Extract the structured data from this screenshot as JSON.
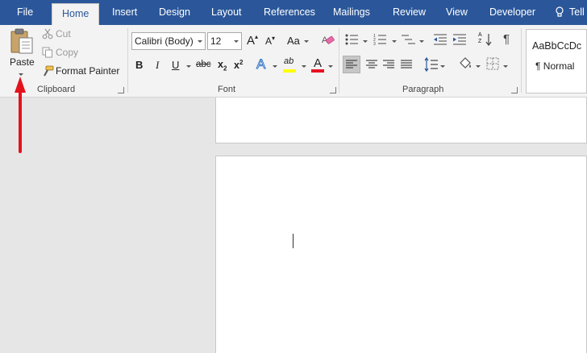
{
  "tabs": {
    "file": "File",
    "home": "Home",
    "insert": "Insert",
    "design": "Design",
    "layout": "Layout",
    "references": "References",
    "mailings": "Mailings",
    "review": "Review",
    "view": "View",
    "developer": "Developer",
    "tell": "Tell"
  },
  "clipboard": {
    "paste": "Paste",
    "cut": "Cut",
    "copy": "Copy",
    "format_painter": "Format Painter",
    "label": "Clipboard"
  },
  "font": {
    "font_name": "Calibri (Body)",
    "font_size": "12",
    "grow": "A",
    "shrink": "A",
    "change_case": "Aa",
    "bold": "B",
    "italic": "I",
    "underline": "U",
    "strikethrough": "abc",
    "subscript": "x",
    "subscript_mark": "2",
    "superscript": "x",
    "superscript_mark": "2",
    "text_effects": "A",
    "highlight": "ab",
    "font_color": "A",
    "label": "Font"
  },
  "paragraph": {
    "sort": "A Z",
    "pilcrow": "¶",
    "label": "Paragraph"
  },
  "styles": {
    "sample": "AaBbCcDc",
    "normal": "¶ Normal"
  },
  "colors": {
    "tabbar": "#2b579a",
    "ribbon": "#f3f3f3",
    "highlight_yellow": "#ffff00",
    "font_color_red": "#e81123",
    "arrow_red": "#e3131b"
  }
}
